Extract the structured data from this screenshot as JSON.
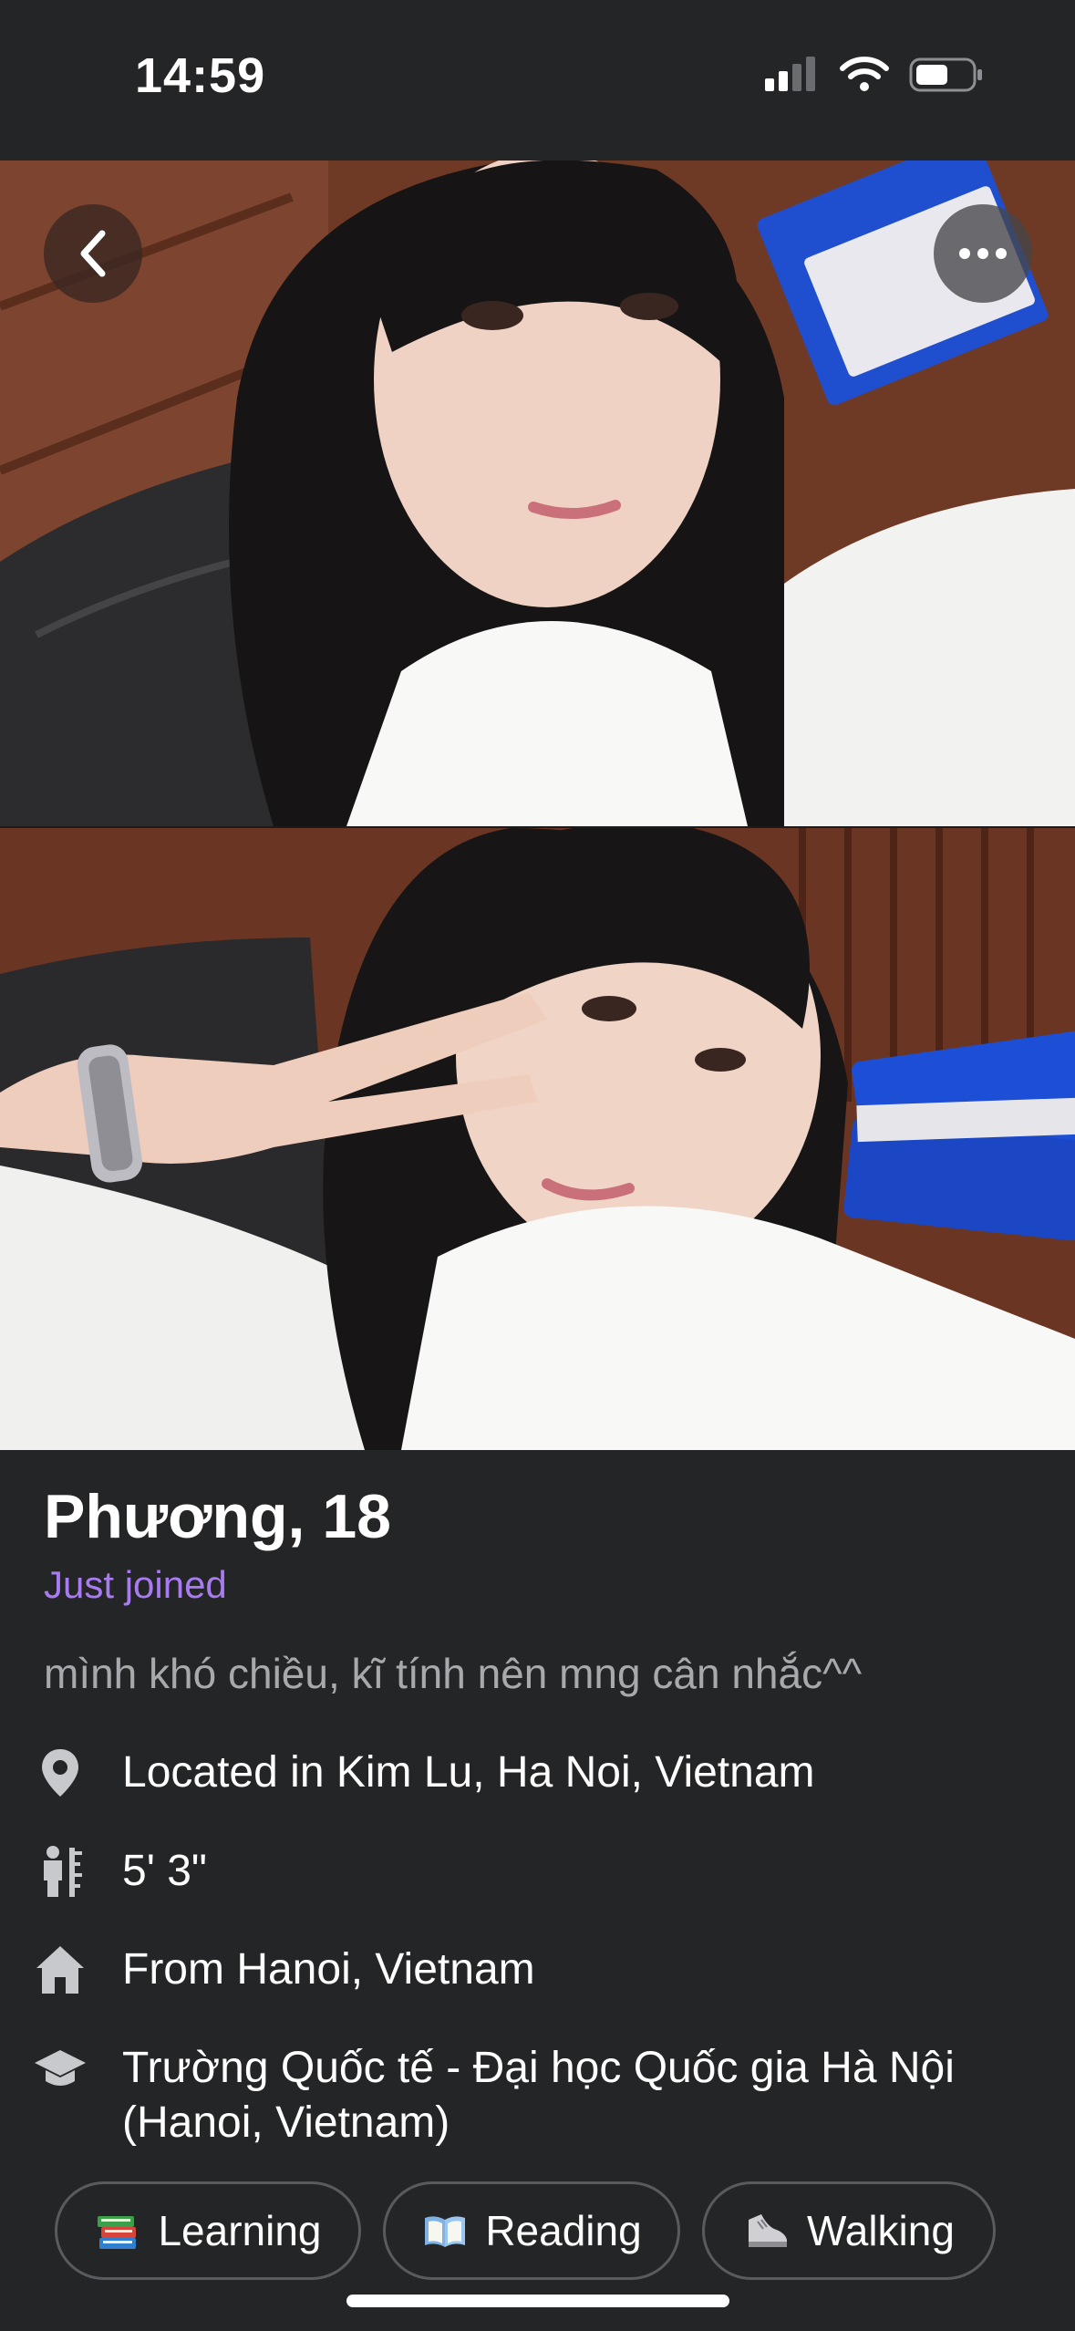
{
  "status_bar": {
    "time": "14:59"
  },
  "profile": {
    "name_age": "Phương, 18",
    "status": "Just joined",
    "bio": "mình khó chiều, kĩ tính nên mng cân nhắc^^",
    "location": "Located in Kim Lu, Ha Noi, Vietnam",
    "height": "5' 3\"",
    "hometown": "From Hanoi, Vietnam",
    "school": "Trường Quốc tế - Đại học Quốc gia Hà Nội (Hanoi, Vietnam)"
  },
  "interests": [
    {
      "label": "Learning",
      "icon": "books-emoji-icon"
    },
    {
      "label": "Reading",
      "icon": "open-book-emoji-icon"
    },
    {
      "label": "Walking",
      "icon": "sneaker-emoji-icon"
    }
  ],
  "colors": {
    "background": "#242526",
    "accent_status": "#a97bf0",
    "bio_text": "#a8a9ad",
    "chip_border": "#5a5b5e"
  }
}
